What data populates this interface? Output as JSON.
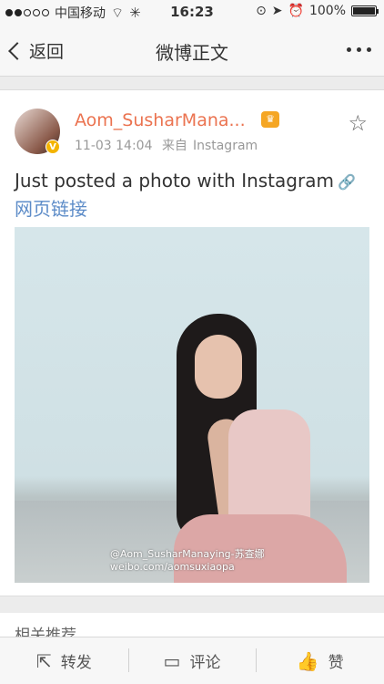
{
  "status_bar": {
    "carrier": "中国移动",
    "time": "16:23",
    "battery_text": "100%",
    "battery_level": 1.0,
    "signal_dots_filled": 2,
    "signal_dots_total": 5
  },
  "nav": {
    "back_label": "返回",
    "title": "微博正文"
  },
  "post": {
    "username": "Aom_SusharMana...",
    "timestamp": "11-03 14:04",
    "source_prefix": "来自",
    "source": "Instagram",
    "verified_badge": "V",
    "text": "Just posted a photo with Instagram",
    "link_label": "网页链接",
    "photo_watermark_line1": "@Aom_SusharManaying-苏查娜",
    "photo_watermark_line2": "weibo.com/aomsuxiaopa"
  },
  "related": {
    "title": "相关推荐"
  },
  "bottom_bar": {
    "repost_label": "转发",
    "comment_label": "评论",
    "like_label": "赞"
  },
  "colors": {
    "accent_username": "#eb7350",
    "link": "#5d8cc8",
    "verified": "#f4b400"
  }
}
